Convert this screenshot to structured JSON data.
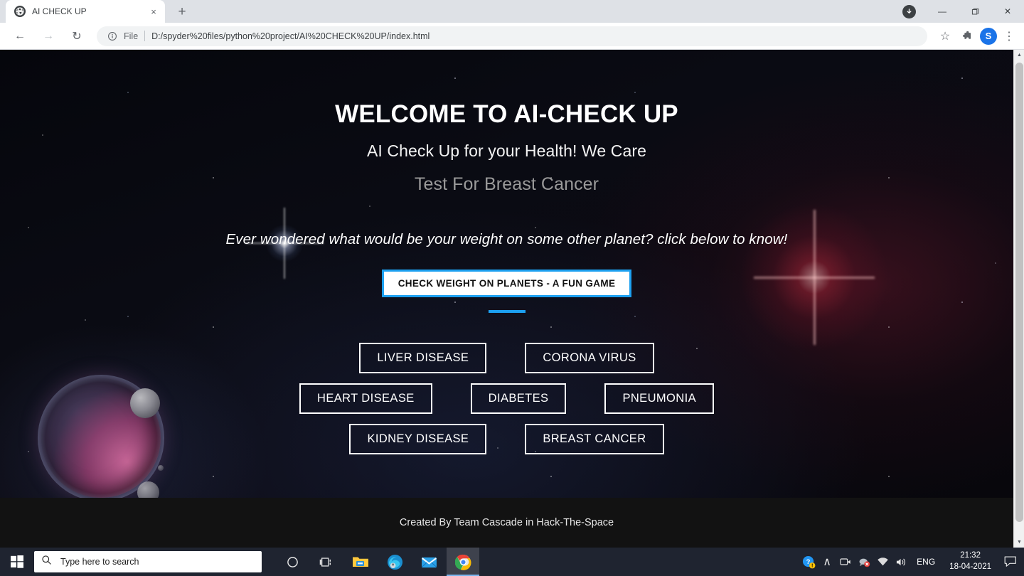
{
  "browser": {
    "tab": {
      "title": "AI CHECK UP",
      "favicon": "globe-icon",
      "close": "×"
    },
    "new_tab": "+",
    "window_controls": {
      "download": "▼",
      "minimize": "—",
      "maximize": "❐",
      "close": "✕"
    },
    "nav": {
      "back": "←",
      "forward": "→",
      "reload": "↻"
    },
    "omnibox": {
      "info_icon": "ⓘ",
      "scheme_label": "File",
      "url": "D:/spyder%20files/python%20project/AI%20CHECK%20UP/index.html"
    },
    "toolbar_icons": {
      "bookmark": "☆",
      "extensions": "puzzle-icon",
      "menu": "⋮"
    },
    "profile_avatar": "S"
  },
  "page": {
    "title": "WELCOME TO AI-CHECK UP",
    "subtitle": "AI Check Up for your Health! We Care",
    "subtitle2": "Test For Breast Cancer",
    "tagline": "Ever wondered what would be your weight on some other planet? click below to know!",
    "cta_button": "CHECK WEIGHT ON PLANETS - A FUN GAME",
    "disease_rows": [
      [
        "LIVER DISEASE",
        "CORONA VIRUS"
      ],
      [
        "HEART DISEASE",
        "DIABETES",
        "PNEUMONIA"
      ],
      [
        "KIDNEY DISEASE",
        "BREAST CANCER"
      ]
    ],
    "footer": "Created By Team Cascade in Hack-The-Space",
    "colors": {
      "accent_blue": "#1ca0f0",
      "button_border": "#ffffff",
      "footer_bg": "#121212",
      "muted_heading": "#9a9a9a"
    }
  },
  "taskbar": {
    "start": "windows-icon",
    "search_placeholder": "Type here to search",
    "search_icon": "search-icon",
    "apps": [
      {
        "name": "cortana",
        "label": "Cortana"
      },
      {
        "name": "task-view",
        "label": "Task View"
      },
      {
        "name": "file-explorer",
        "label": "File Explorer"
      },
      {
        "name": "microsoft-edge",
        "label": "Microsoft Edge"
      },
      {
        "name": "mail",
        "label": "Mail"
      },
      {
        "name": "google-chrome",
        "label": "Google Chrome"
      }
    ],
    "tray": {
      "help": "help-icon",
      "show_hidden": "∧",
      "camera": "camera-icon",
      "muted": "muted-icon",
      "network": "wifi-icon",
      "volume": "speaker-icon",
      "language": "ENG",
      "time": "21:32",
      "date": "18-04-2021",
      "action_center": "action-center-icon"
    }
  }
}
